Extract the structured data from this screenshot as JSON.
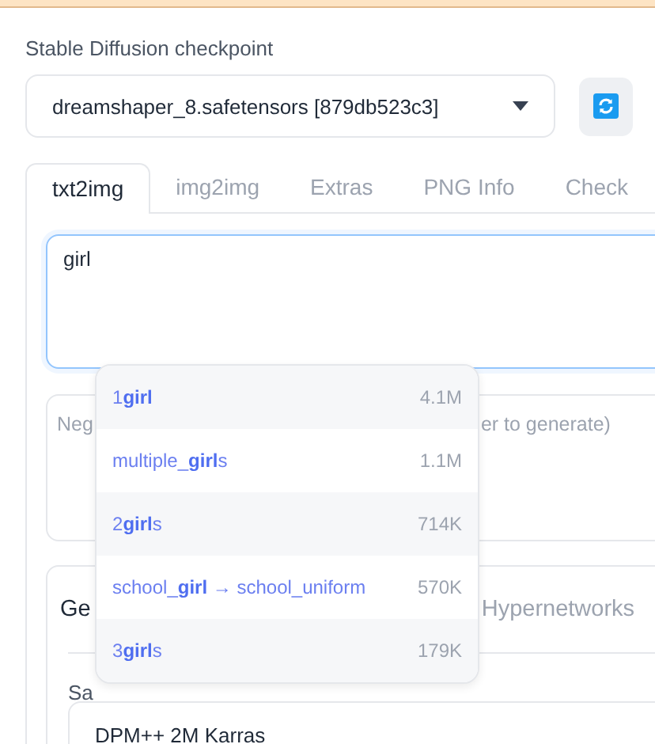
{
  "checkpoint": {
    "label": "Stable Diffusion checkpoint",
    "value": "dreamshaper_8.safetensors [879db523c3]"
  },
  "tabs": [
    {
      "label": "txt2img",
      "selected": true
    },
    {
      "label": "img2img",
      "selected": false
    },
    {
      "label": "Extras",
      "selected": false
    },
    {
      "label": "PNG Info",
      "selected": false
    },
    {
      "label": "Check",
      "selected": false
    }
  ],
  "prompt": {
    "value": "girl"
  },
  "negative_prompt": {
    "visible_text": [
      "Neg",
      "er to generate)"
    ]
  },
  "settings_tabs": [
    {
      "label": "Ge",
      "selected": true
    },
    {
      "label": "Hypernetworks",
      "selected": false
    }
  ],
  "sampler": {
    "label": "Sa",
    "value": "DPM++ 2M Karras"
  },
  "autocomplete": [
    {
      "tag": "1**girl**",
      "count": "4.1M"
    },
    {
      "tag": "multiple_**girl**s",
      "count": "1.1M"
    },
    {
      "tag": "2**girl**s",
      "count": "714K"
    },
    {
      "tag": "school_**girl** → school_uniform",
      "count": "570K"
    },
    {
      "tag": "3**girl**s",
      "count": "179K"
    }
  ]
}
